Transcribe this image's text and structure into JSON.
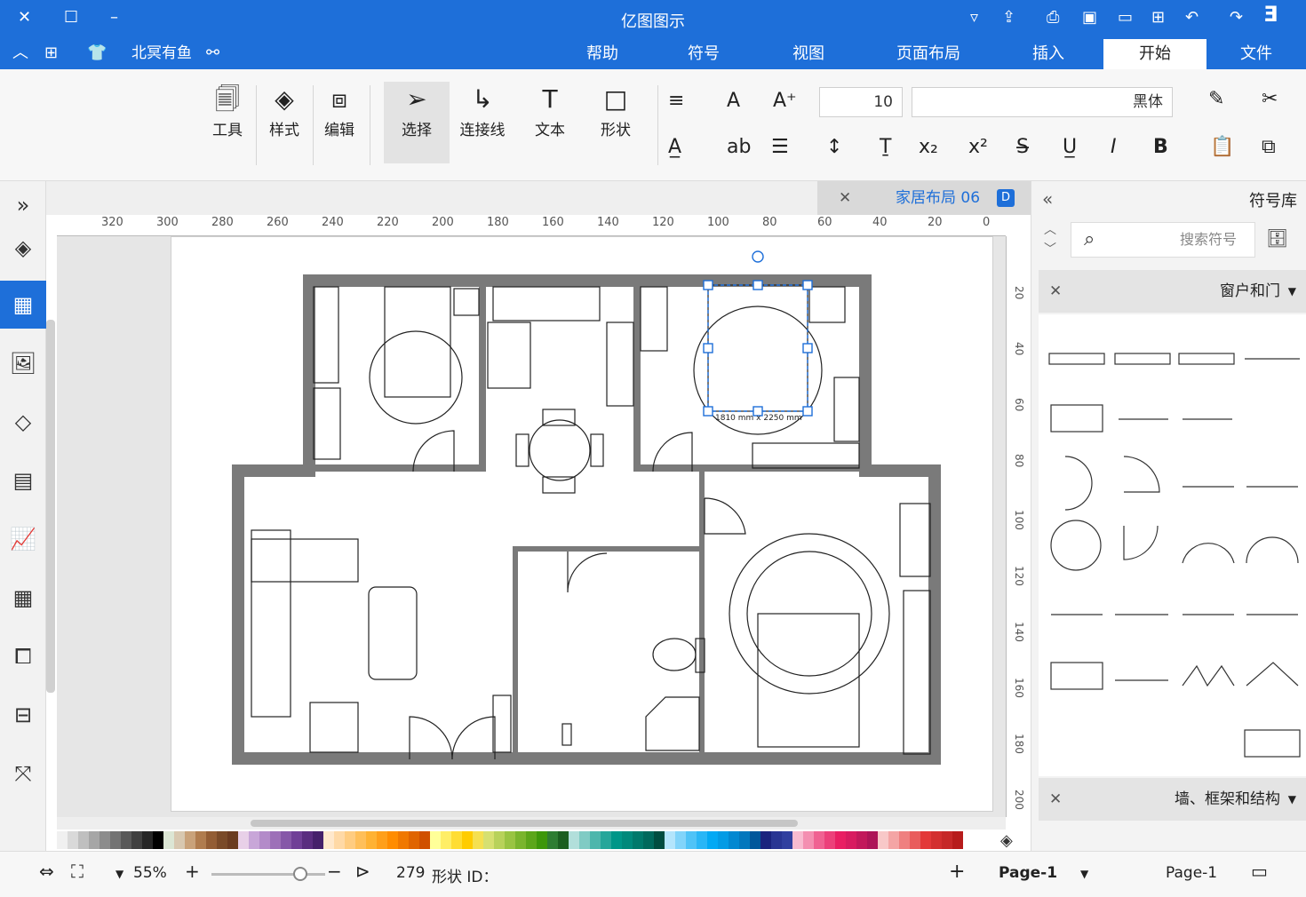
{
  "app": {
    "title": "亿图图示"
  },
  "quick_access": [
    "undo-icon",
    "redo-icon",
    "new-icon",
    "open-icon",
    "save-icon",
    "print-icon",
    "export-icon",
    "more-icon"
  ],
  "menu_tabs": [
    {
      "label": "文件"
    },
    {
      "label": "开始"
    },
    {
      "label": "插入"
    },
    {
      "label": "页面布局"
    },
    {
      "label": "视图"
    },
    {
      "label": "符号"
    },
    {
      "label": "帮助"
    }
  ],
  "user": {
    "name": "北冥有鱼"
  },
  "ribbon": {
    "font_name": "黑体",
    "font_size": "10",
    "big_buttons": [
      {
        "label": "形状"
      },
      {
        "label": "文本"
      },
      {
        "label": "连接线"
      },
      {
        "label": "选择"
      },
      {
        "label": "编辑"
      },
      {
        "label": "样式"
      },
      {
        "label": "工具"
      }
    ]
  },
  "document": {
    "tab_name": "家居布局 06"
  },
  "ruler_h": [
    "0",
    "20",
    "40",
    "60",
    "80",
    "100",
    "120",
    "140",
    "160",
    "180",
    "200",
    "220",
    "240",
    "260",
    "280",
    "300",
    "320"
  ],
  "ruler_v": [
    "20",
    "40",
    "60",
    "80",
    "100",
    "120",
    "140",
    "160",
    "180",
    "200"
  ],
  "floorplan": {
    "bed_dimension": "1810 mm x 2250 mm"
  },
  "right_panel": {
    "title": "符号库",
    "search_placeholder": "搜索符号",
    "section1": "窗户和门",
    "section2": "墙、框架和结构"
  },
  "status": {
    "page_name": "Page-1",
    "page_tab": "Page-1",
    "shape_id_label": "形状 ID：",
    "shape_id": "279",
    "zoom": "55%"
  },
  "palette": [
    "#ffffff",
    "#f0f0f0",
    "#d9d9d9",
    "#bfbfbf",
    "#a6a6a6",
    "#8c8c8c",
    "#737373",
    "#595959",
    "#404040",
    "#262626",
    "#000000",
    "#dce6d4",
    "#d8c8b0",
    "#c9a27a",
    "#b07c4e",
    "#935d34",
    "#7a4a28",
    "#6b3b20",
    "#e8d0e8",
    "#c8a6d8",
    "#b38bc9",
    "#9d70b8",
    "#8657a8",
    "#703f97",
    "#5a2d80",
    "#45206b",
    "#ffe8cc",
    "#ffd9a6",
    "#ffcc80",
    "#ffbf59",
    "#ffb233",
    "#ff9f1a",
    "#ff8c00",
    "#f07800",
    "#e06400",
    "#d05000",
    "#ffff99",
    "#ffee66",
    "#ffdd33",
    "#ffcc00",
    "#f5e050",
    "#d6e070",
    "#b8d25a",
    "#99c442",
    "#7ab52d",
    "#5ca61a",
    "#3d970a",
    "#2e7d32",
    "#1b5e20",
    "#b2dfdb",
    "#80cbc4",
    "#4db6ac",
    "#26a69a",
    "#009688",
    "#00897b",
    "#00796b",
    "#00695c",
    "#004d40",
    "#b3e5fc",
    "#81d4fa",
    "#4fc3f7",
    "#29b6f6",
    "#03a9f4",
    "#039be5",
    "#0288d1",
    "#0277bd",
    "#01579b",
    "#1a237e",
    "#283593",
    "#303f9f",
    "#f8bbd0",
    "#f48fb1",
    "#f06292",
    "#ec407a",
    "#e91e63",
    "#d81b60",
    "#c2185b",
    "#ad1457",
    "#f8c8c8",
    "#f4a5a5",
    "#ef8080",
    "#e95c5c",
    "#e33838",
    "#d32f2f",
    "#c62828",
    "#b71c1c"
  ]
}
